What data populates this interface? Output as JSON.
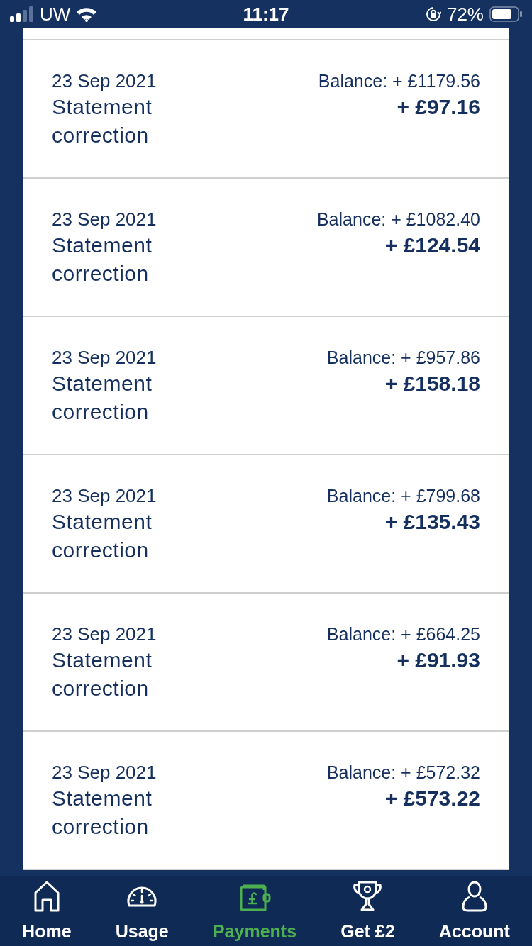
{
  "status_bar": {
    "carrier": "UW",
    "time": "11:17",
    "battery": "72%"
  },
  "transactions": [
    {
      "date": "23 Sep 2021",
      "description": "Statement correction",
      "balance": "Balance: + £1179.56",
      "amount": "+ £97.16"
    },
    {
      "date": "23 Sep 2021",
      "description": "Statement correction",
      "balance": "Balance: + £1082.40",
      "amount": "+ £124.54"
    },
    {
      "date": "23 Sep 2021",
      "description": "Statement correction",
      "balance": "Balance: + £957.86",
      "amount": "+ £158.18"
    },
    {
      "date": "23 Sep 2021",
      "description": "Statement correction",
      "balance": "Balance: + £799.68",
      "amount": "+ £135.43"
    },
    {
      "date": "23 Sep 2021",
      "description": "Statement correction",
      "balance": "Balance: + £664.25",
      "amount": "+ £91.93"
    },
    {
      "date": "23 Sep 2021",
      "description": "Statement correction",
      "balance": "Balance: + £572.32",
      "amount": "+ £573.22"
    }
  ],
  "tab_bar": [
    {
      "label": "Home",
      "kind": "home",
      "selected": false
    },
    {
      "label": "Usage",
      "kind": "usage",
      "selected": false
    },
    {
      "label": "Payments",
      "kind": "payments",
      "selected": true
    },
    {
      "label": "Get £2",
      "kind": "reward",
      "selected": false
    },
    {
      "label": "Account",
      "kind": "account",
      "selected": false
    }
  ]
}
